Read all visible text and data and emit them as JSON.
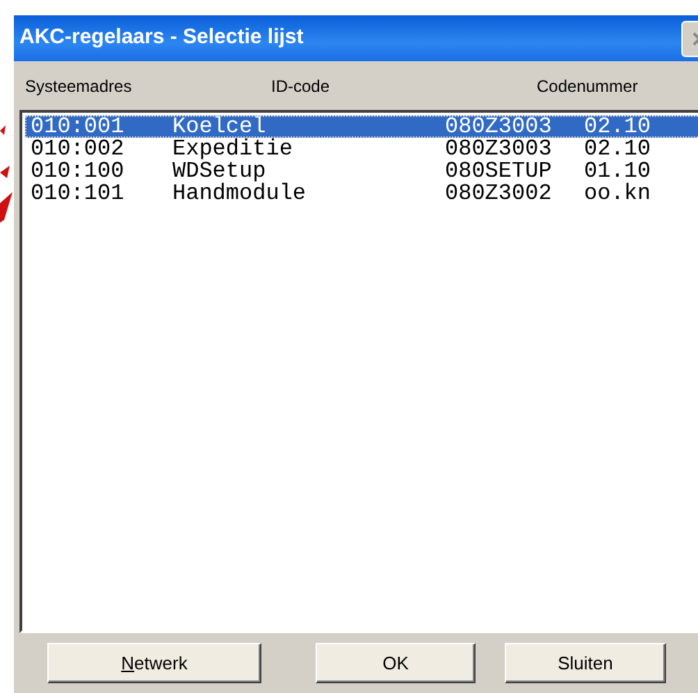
{
  "window": {
    "title": "AKC-regelaars - Selectie lijst"
  },
  "columns": [
    "Systeemadres",
    "ID-code",
    "Codenummer"
  ],
  "rows": [
    {
      "address": "010:001",
      "name": "Koelcel",
      "code": "080Z3003",
      "version": "02.10",
      "selected": true
    },
    {
      "address": "010:002",
      "name": "Expeditie",
      "code": "080Z3003",
      "version": "02.10",
      "selected": false
    },
    {
      "address": "010:100",
      "name": "WDSetup",
      "code": "080SETUP",
      "version": "01.10",
      "selected": false
    },
    {
      "address": "010:101",
      "name": "Handmodule",
      "code": "080Z3002",
      "version": "oo.kn",
      "selected": false
    }
  ],
  "buttons": [
    {
      "label": "Netwerk",
      "mnemonic_first": true
    },
    {
      "label": "OK",
      "mnemonic_first": false
    },
    {
      "label": "Sluiten",
      "mnemonic_first": false
    }
  ]
}
